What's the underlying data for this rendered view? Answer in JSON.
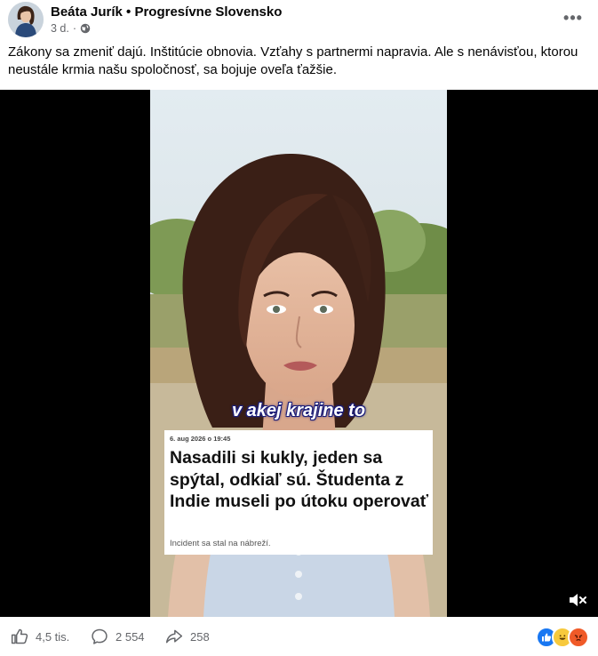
{
  "post": {
    "author": "Beáta Jurík • Progresívne Slovensko",
    "time": "3 d.",
    "text": "Zákony sa zmeniť dajú. Inštitúcie obnovia. Vzťahy s partnermi napravia. Ale s nenávisťou, ktorou neustále krmia našu spoločnosť, sa bojuje oveľa ťažšie.",
    "icons": {
      "privacy": "globe-icon",
      "more": "more-options-icon"
    }
  },
  "video": {
    "subtitle": "v akej krajine to",
    "card": {
      "date": "6. aug 2026 o 19:45",
      "title": "Nasadili si kukly, jeden sa spýtal, odkiaľ sú. Študenta z Indie museli po útoku operovať",
      "subtitle": "Incident sa stal na nábreží."
    },
    "mute_icon": "speaker-muted-icon"
  },
  "actions": {
    "likes": "4,5 tis.",
    "comments": "2 554",
    "shares": "258"
  },
  "colors": {
    "like_blue": "#1877f2",
    "muted_text": "#65676b",
    "subtitle_outline": "#1d1f7a"
  }
}
